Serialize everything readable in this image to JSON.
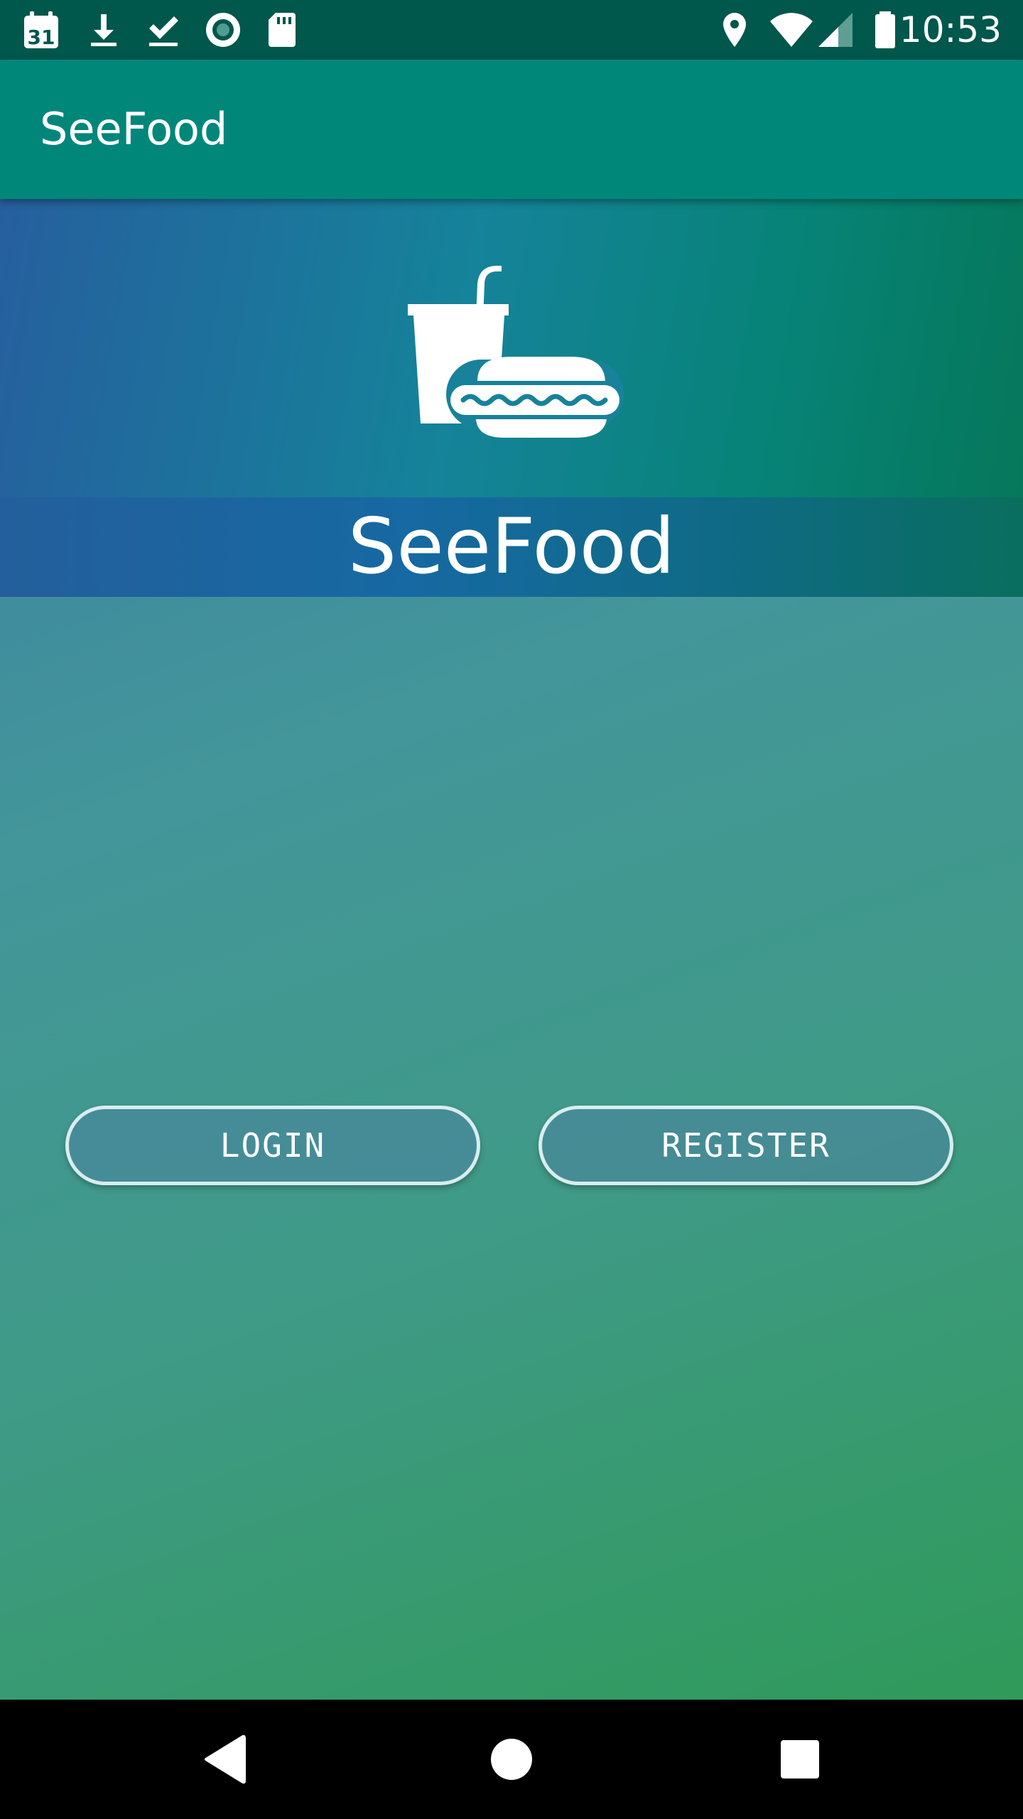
{
  "status_bar": {
    "calendar_day": "31",
    "time": "10:53",
    "icons": [
      "calendar-icon",
      "download-icon",
      "check-icon",
      "record-icon",
      "sd-card-icon",
      "location-icon",
      "wifi-icon",
      "signal-icon",
      "battery-icon"
    ]
  },
  "app_bar": {
    "title": "SeeFood"
  },
  "hero": {
    "logo_icon": "fastfood-icon",
    "title": "SeeFood"
  },
  "actions": {
    "login_label": "LOGIN",
    "register_label": "REGISTER"
  },
  "nav_bar": {
    "icons": [
      "back-icon",
      "home-icon",
      "recents-icon"
    ]
  },
  "colors": {
    "status_bar": "#00574b",
    "app_bar": "#00877a",
    "button_border": "#d9ecef"
  }
}
